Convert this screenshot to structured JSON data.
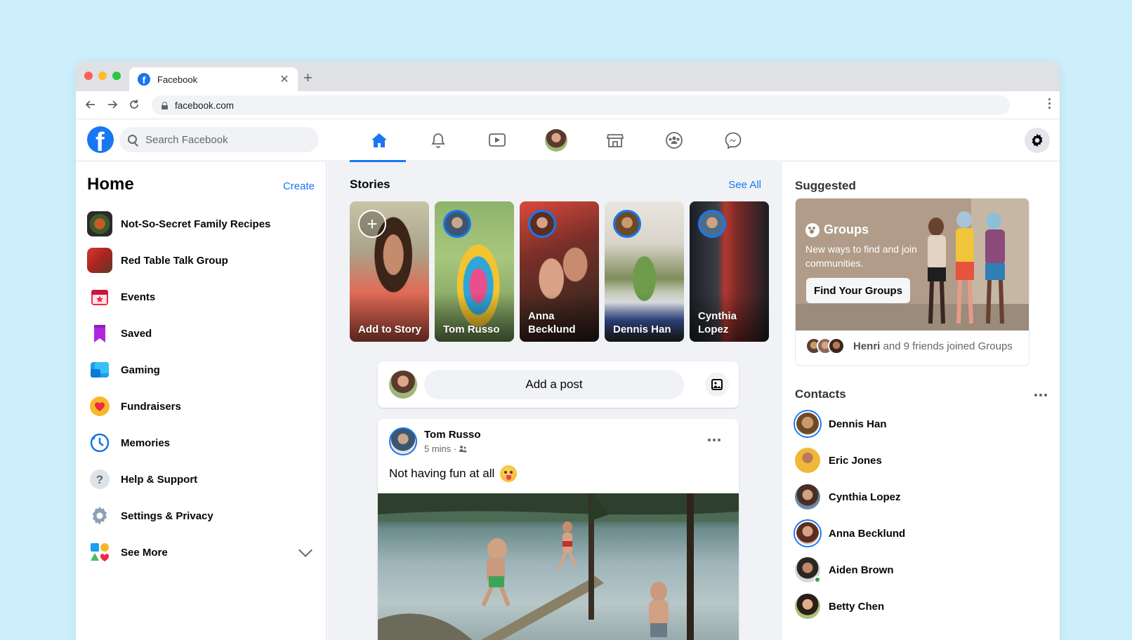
{
  "browser": {
    "tab_title": "Facebook",
    "url": "facebook.com"
  },
  "topnav": {
    "search_placeholder": "Search Facebook",
    "active_tab": "home",
    "icons": [
      "home-icon",
      "bell-icon",
      "watch-icon",
      "profile-avatar",
      "marketplace-icon",
      "groups-icon",
      "messenger-icon"
    ],
    "settings_icon": "gear-icon",
    "accent_color": "#1877f2"
  },
  "sidebar": {
    "title": "Home",
    "create_label": "Create",
    "items": [
      {
        "label": "Not-So-Secret Family Recipes",
        "icon": "group-photo-recipes"
      },
      {
        "label": "Red Table Talk Group",
        "icon": "group-photo-redtable"
      },
      {
        "label": "Events",
        "icon": "calendar-star-icon"
      },
      {
        "label": "Saved",
        "icon": "bookmark-icon"
      },
      {
        "label": "Gaming",
        "icon": "gaming-icon"
      },
      {
        "label": "Fundraisers",
        "icon": "heart-icon"
      },
      {
        "label": "Memories",
        "icon": "clock-icon"
      },
      {
        "label": "Help & Support",
        "icon": "question-icon"
      },
      {
        "label": "Settings & Privacy",
        "icon": "gear-icon"
      },
      {
        "label": "See More",
        "icon": "shapes-icon"
      }
    ]
  },
  "feed": {
    "stories_title": "Stories",
    "see_all_label": "See All",
    "stories": [
      {
        "name": "Add to Story"
      },
      {
        "name": "Tom Russo"
      },
      {
        "name": "Anna Becklund"
      },
      {
        "name": "Dennis Han"
      },
      {
        "name": "Cynthia Lopez"
      }
    ],
    "composer_placeholder": "Add a post",
    "post": {
      "author": "Tom Russo",
      "time": "5 mins ·",
      "text": "Not having fun at all"
    }
  },
  "suggested": {
    "title": "Suggested",
    "card_title": "Groups",
    "card_desc": "New ways to find and join communities.",
    "button_label": "Find Your Groups",
    "footer_name": "Henri",
    "footer_rest": "and 9 friends joined Groups"
  },
  "contacts": {
    "title": "Contacts",
    "list": [
      {
        "name": "Dennis Han"
      },
      {
        "name": "Eric Jones"
      },
      {
        "name": "Cynthia Lopez"
      },
      {
        "name": "Anna Becklund"
      },
      {
        "name": "Aiden Brown"
      },
      {
        "name": "Betty Chen"
      }
    ]
  }
}
